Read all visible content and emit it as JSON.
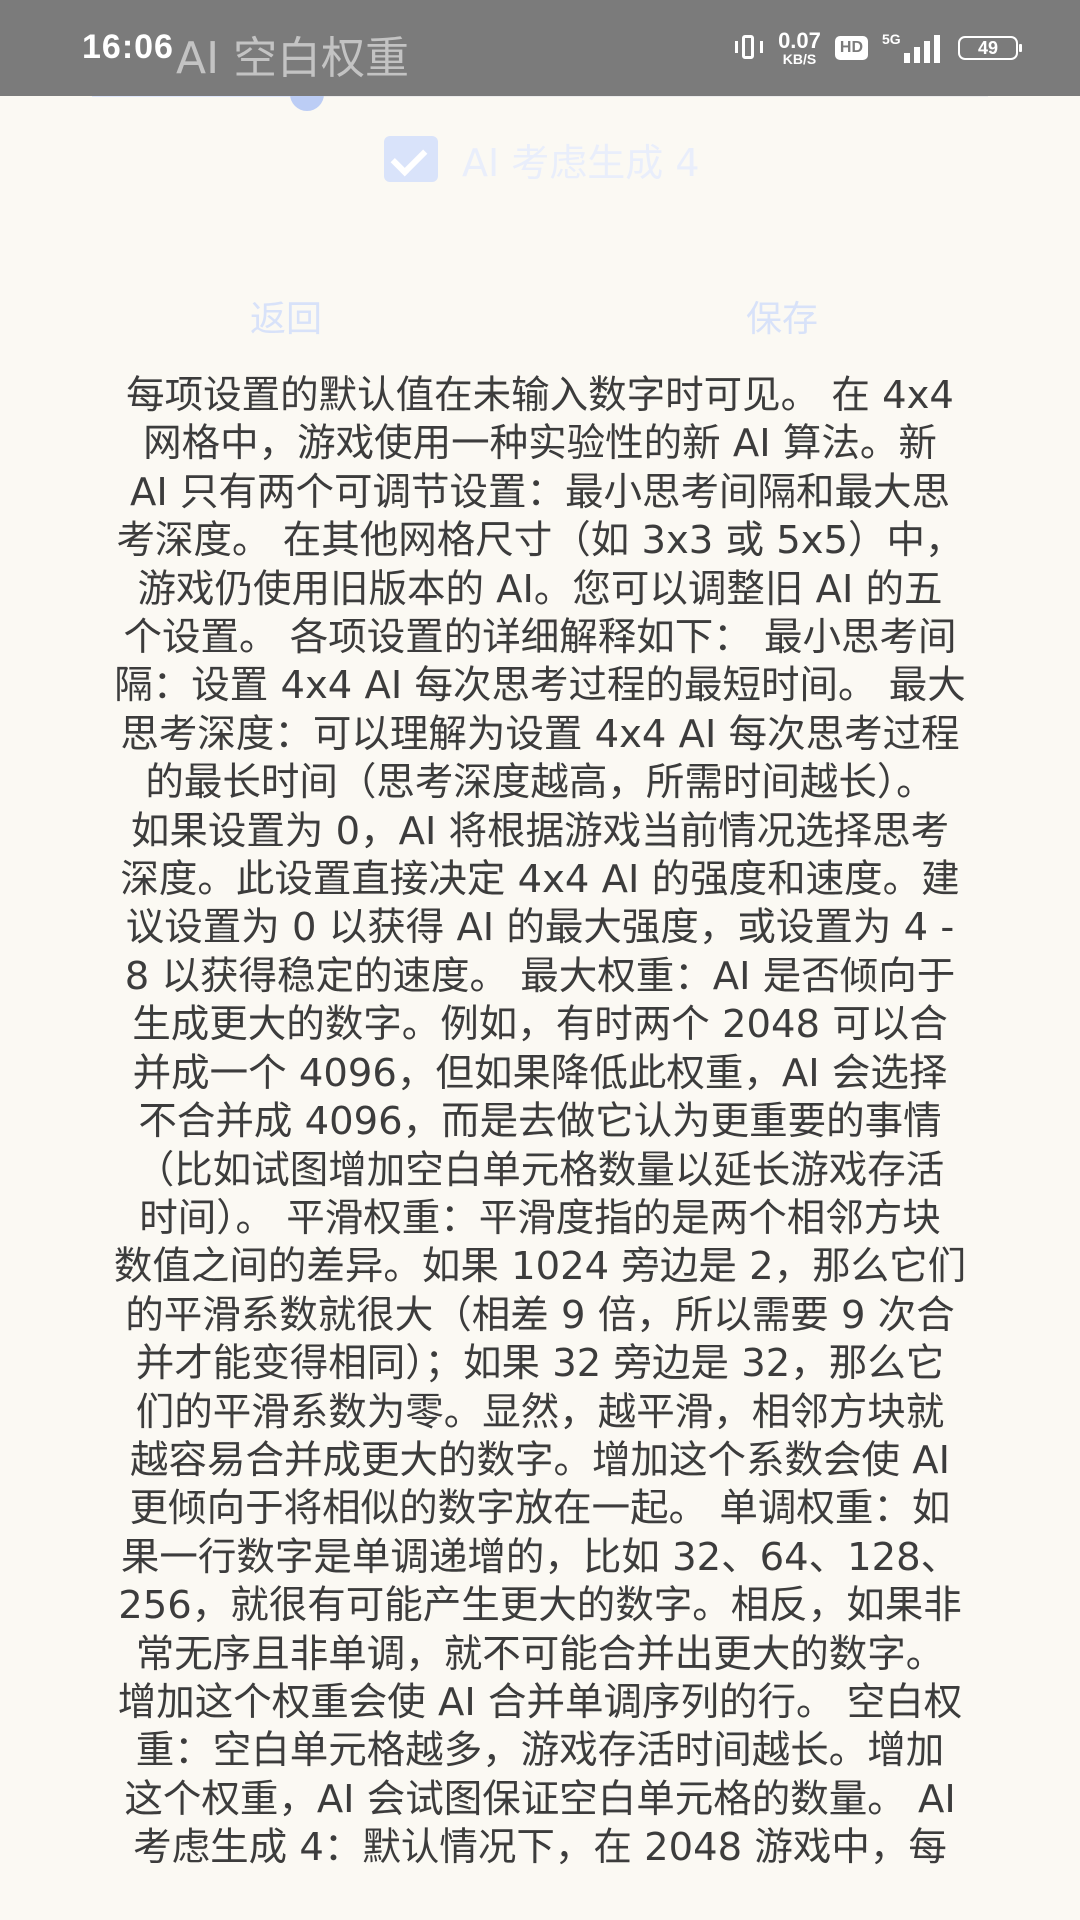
{
  "status_bar": {
    "time": "16:06",
    "behind_title": "AI 空白权重",
    "net_speed_value": "0.07",
    "net_speed_unit": "KB/S",
    "hd_label": "HD",
    "network_type": "5G",
    "battery": "49"
  },
  "slider": {
    "value_fraction": 0.24
  },
  "settings": {
    "consider_spawn4_label": "AI 考虑生成 4",
    "consider_spawn4_checked": true
  },
  "buttons": {
    "back": "返回",
    "save": "保存"
  },
  "help_text": "每项设置的默认值在未输入数字时可见。 在 4x4\n网格中，游戏使用一种实验性的新 AI 算法。新\nAI 只有两个可调节设置：最小思考间隔和最大思\n考深度。 在其他网格尺寸（如 3x3 或 5x5）中，\n游戏仍使用旧版本的 AI。您可以调整旧 AI 的五\n个设置。 各项设置的详细解释如下： 最小思考间\n隔：设置 4x4 AI 每次思考过程的最短时间。 最大\n思考深度：可以理解为设置 4x4 AI 每次思考过程\n的最长时间（思考深度越高，所需时间越长）。\n如果设置为 0，AI 将根据游戏当前情况选择思考\n深度。此设置直接决定 4x4 AI 的强度和速度。建\n议设置为 0 以获得 AI 的最大强度，或设置为 4 -\n8 以获得稳定的速度。 最大权重：AI 是否倾向于\n生成更大的数字。例如，有时两个 2048 可以合\n并成一个 4096，但如果降低此权重，AI 会选择\n不合并成 4096，而是去做它认为更重要的事情\n（比如试图增加空白单元格数量以延长游戏存活\n时间）。 平滑权重：平滑度指的是两个相邻方块\n数值之间的差异。如果 1024 旁边是 2，那么它们\n的平滑系数就很大（相差 9 倍，所以需要 9 次合\n并才能变得相同）；如果 32 旁边是 32，那么它\n们的平滑系数为零。显然，越平滑，相邻方块就\n越容易合并成更大的数字。增加这个系数会使 AI\n更倾向于将相似的数字放在一起。 单调权重：如\n果一行数字是单调递增的，比如 32、64、128、\n256，就很有可能产生更大的数字。相反，如果非\n常无序且非单调，就不可能合并出更大的数字。\n增加这个权重会使 AI 合并单调序列的行。 空白权\n重：空白单元格越多，游戏存活时间越长。增加\n这个权重，AI 会试图保证空白单元格的数量。 AI\n考虑生成 4：默认情况下，在 2048 游戏中，每"
}
